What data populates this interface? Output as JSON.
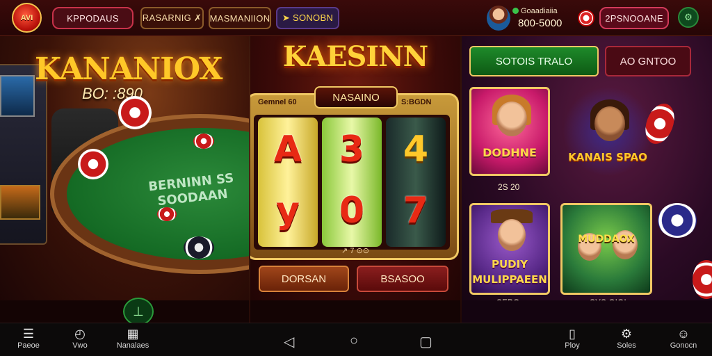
{
  "topbar": {
    "logo_text": "AVI",
    "tab1": "KPPODAUS",
    "tab2": "RASARNIG ✗",
    "tab3": "MASMANIION",
    "tab4": "➤ SONOBN",
    "user_name": "Goaadiaiia",
    "balance": "800-5000",
    "tab5": "2PSNOOANE",
    "settings_icon": "gear-icon"
  },
  "left_panel": {
    "title": "KANANIOX",
    "bonus": "BO: :890",
    "felt_text": "BERNINN SS\nSOODAAN",
    "home_icon": "home-icon"
  },
  "middle_panel": {
    "title": "KAESINN",
    "slot_label_left": "Gemnel 60",
    "slot_name": "NASAINO",
    "slot_label_right": "S:BGDN",
    "reels": [
      {
        "top": "A",
        "bottom": "y"
      },
      {
        "top": "3",
        "bottom": "0"
      },
      {
        "top": "4",
        "bottom": "7"
      }
    ],
    "slot_footer": "↗ 7 ⊙⊙",
    "button_left": "DORSAN",
    "button_right": "BSASOO"
  },
  "right_panel": {
    "green_button": "SOTOIS TRALO",
    "dark_button": "AO GNTOO",
    "cards": [
      {
        "title": "DODHNE",
        "label": "2S 20"
      },
      {
        "title": "KANAIS SPAO",
        "label": ""
      },
      {
        "title": "PUDIY MULIPPAEEN",
        "label": "SEBO"
      },
      {
        "title": "MUDDAOX BALDOK",
        "label": "SYS.OIOI"
      }
    ]
  },
  "bottom_nav": {
    "left": [
      {
        "icon": "square-menu-icon",
        "label": "Paeoe"
      },
      {
        "icon": "clock-icon",
        "label": "Vwo"
      },
      {
        "icon": "grid-icon",
        "label": "Nanalaes"
      }
    ],
    "right": [
      {
        "icon": "phone-icon",
        "label": "Ploy"
      },
      {
        "icon": "gear-icon",
        "label": "Soles"
      },
      {
        "icon": "chat-icon",
        "label": "Gonocn"
      }
    ]
  },
  "colors": {
    "accent_gold": "#f0c864",
    "brand_red": "#c81a1a",
    "felt_green": "#146a24"
  }
}
